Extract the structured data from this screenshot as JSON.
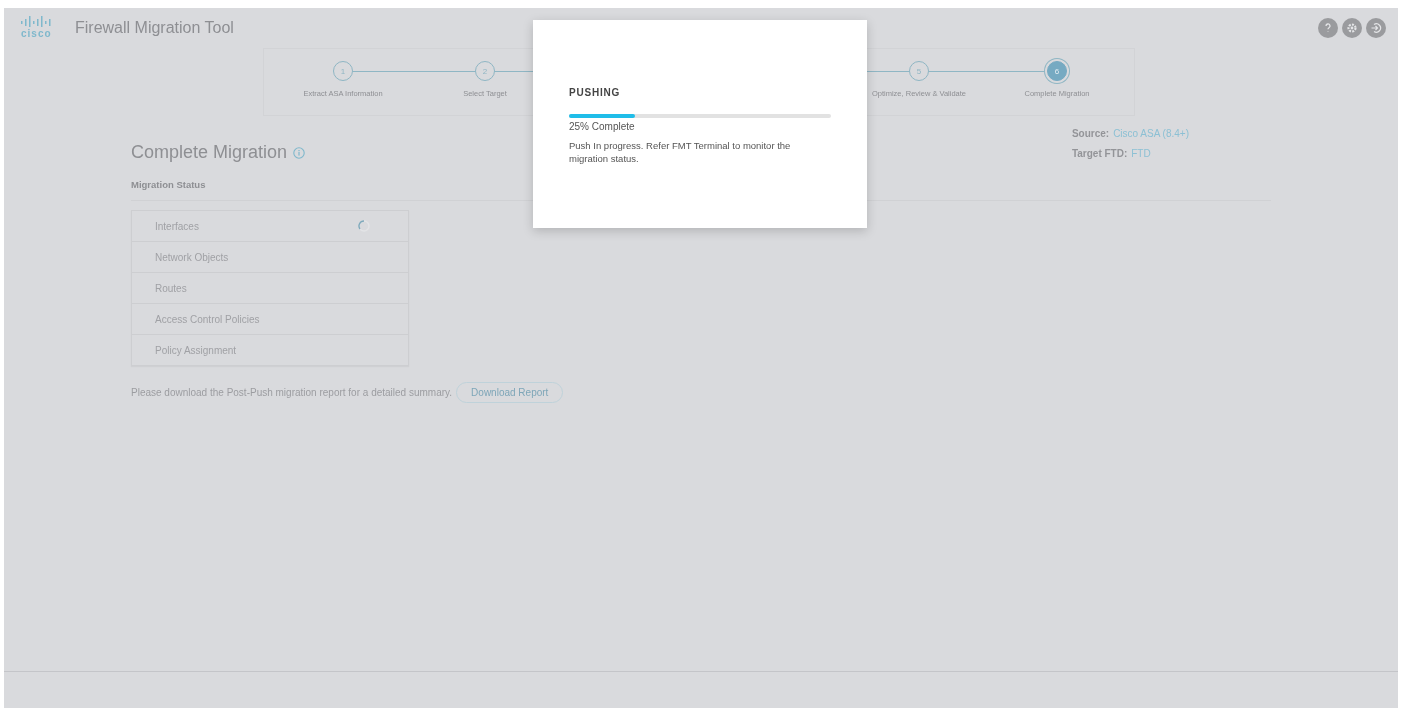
{
  "header": {
    "logo": "cisco",
    "title": "Firewall Migration Tool"
  },
  "steps": [
    {
      "number": "1",
      "label": "Extract ASA Information",
      "selected": false
    },
    {
      "number": "2",
      "label": "Select Target",
      "selected": false
    },
    {
      "number": "5",
      "label": "Optimize, Review & Validate",
      "selected": false
    },
    {
      "number": "6",
      "label": "Complete Migration",
      "selected": true
    }
  ],
  "page": {
    "title": "Complete Migration",
    "source_label": "Source:",
    "source_value": "Cisco ASA (8.4+)",
    "target_label": "Target FTD:",
    "target_value": "FTD"
  },
  "migration_status": {
    "title": "Migration Status",
    "items": [
      {
        "name": "Interfaces",
        "in_progress": true
      },
      {
        "name": "Network Objects",
        "in_progress": false
      },
      {
        "name": "Routes",
        "in_progress": false
      },
      {
        "name": "Access Control Policies",
        "in_progress": false
      },
      {
        "name": "Policy Assignment",
        "in_progress": false
      }
    ]
  },
  "report": {
    "text": "Please download the Post-Push migration report for a detailed summary.",
    "button": "Download Report"
  },
  "modal": {
    "title": "PUSHING",
    "level": 0.25,
    "progress_text": "25% Complete",
    "message": "Push In progress. Refer FMT Terminal to monitor the migration status."
  }
}
